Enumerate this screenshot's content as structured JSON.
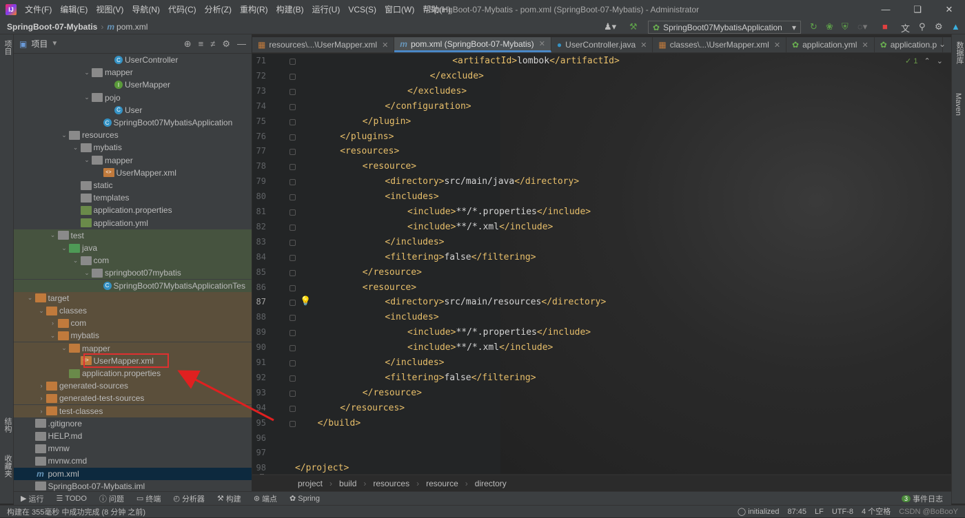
{
  "titlebar": {
    "menu": [
      "文件(F)",
      "编辑(E)",
      "视图(V)",
      "导航(N)",
      "代码(C)",
      "分析(Z)",
      "重构(R)",
      "构建(B)",
      "运行(U)",
      "VCS(S)",
      "窗口(W)",
      "帮助(H)"
    ],
    "window_title": "SpringBoot-07-Mybatis - pom.xml (SpringBoot-07-Mybatis) - Administrator"
  },
  "navbar": {
    "project": "SpringBoot-07-Mybatis",
    "file": "pom.xml",
    "run_config": "SpringBoot07MybatisApplication"
  },
  "left_strip": {
    "project_label": "项目",
    "structure_label": "结构",
    "favorites_label": "收藏夹"
  },
  "right_strip": {
    "database_label": "数据库",
    "maven_label": "Maven"
  },
  "project_panel": {
    "title": "项目",
    "tree": [
      {
        "label": "UserController",
        "indent": 8,
        "icon": "class",
        "arrow": ""
      },
      {
        "label": "mapper",
        "indent": 6,
        "icon": "folder",
        "arrow": "v"
      },
      {
        "label": "UserMapper",
        "indent": 8,
        "icon": "interface",
        "arrow": ""
      },
      {
        "label": "pojo",
        "indent": 6,
        "icon": "folder",
        "arrow": "v"
      },
      {
        "label": "User",
        "indent": 8,
        "icon": "class",
        "arrow": ""
      },
      {
        "label": "SpringBoot07MybatisApplication",
        "indent": 7,
        "icon": "springclass",
        "arrow": ""
      },
      {
        "label": "resources",
        "indent": 4,
        "icon": "folder",
        "arrow": "v"
      },
      {
        "label": "mybatis",
        "indent": 5,
        "icon": "folder",
        "arrow": "v"
      },
      {
        "label": "mapper",
        "indent": 6,
        "icon": "folder",
        "arrow": "v"
      },
      {
        "label": "UserMapper.xml",
        "indent": 7,
        "icon": "xml",
        "arrow": ""
      },
      {
        "label": "static",
        "indent": 5,
        "icon": "folder",
        "arrow": ""
      },
      {
        "label": "templates",
        "indent": 5,
        "icon": "folder",
        "arrow": ""
      },
      {
        "label": "application.properties",
        "indent": 5,
        "icon": "prop",
        "arrow": ""
      },
      {
        "label": "application.yml",
        "indent": 5,
        "icon": "prop",
        "arrow": ""
      },
      {
        "label": "test",
        "indent": 3,
        "icon": "folder",
        "arrow": "v",
        "hl": "green"
      },
      {
        "label": "java",
        "indent": 4,
        "icon": "folder-src",
        "arrow": "v",
        "hl": "green"
      },
      {
        "label": "com",
        "indent": 5,
        "icon": "folder",
        "arrow": "v",
        "hl": "green"
      },
      {
        "label": "springboot07mybatis",
        "indent": 6,
        "icon": "folder",
        "arrow": "v",
        "hl": "green"
      },
      {
        "label": "SpringBoot07MybatisApplicationTes",
        "indent": 7,
        "icon": "springclass",
        "arrow": "",
        "hl": "green"
      },
      {
        "label": "target",
        "indent": 1,
        "icon": "folder-orange",
        "arrow": "v",
        "hl": "orange"
      },
      {
        "label": "classes",
        "indent": 2,
        "icon": "folder-orange",
        "arrow": "v",
        "hl": "orange"
      },
      {
        "label": "com",
        "indent": 3,
        "icon": "folder-orange",
        "arrow": ">",
        "hl": "orange"
      },
      {
        "label": "mybatis",
        "indent": 3,
        "icon": "folder-orange",
        "arrow": "v",
        "hl": "orange"
      },
      {
        "label": "mapper",
        "indent": 4,
        "icon": "folder-orange",
        "arrow": "v",
        "hl": "orange"
      },
      {
        "label": "UserMapper.xml",
        "indent": 5,
        "icon": "xml",
        "arrow": "",
        "hl": "orange"
      },
      {
        "label": "application.properties",
        "indent": 4,
        "icon": "prop",
        "arrow": "",
        "hl": "orange"
      },
      {
        "label": "generated-sources",
        "indent": 2,
        "icon": "folder-orange",
        "arrow": ">",
        "hl": "orange"
      },
      {
        "label": "generated-test-sources",
        "indent": 2,
        "icon": "folder-orange",
        "arrow": ">",
        "hl": "orange"
      },
      {
        "label": "test-classes",
        "indent": 2,
        "icon": "folder-orange",
        "arrow": ">",
        "hl": "orange"
      },
      {
        "label": ".gitignore",
        "indent": 1,
        "icon": "txt",
        "arrow": ""
      },
      {
        "label": "HELP.md",
        "indent": 1,
        "icon": "txt",
        "arrow": ""
      },
      {
        "label": "mvnw",
        "indent": 1,
        "icon": "txt",
        "arrow": ""
      },
      {
        "label": "mvnw.cmd",
        "indent": 1,
        "icon": "txt",
        "arrow": ""
      },
      {
        "label": "pom.xml",
        "indent": 1,
        "icon": "maven",
        "arrow": "",
        "selected": true
      },
      {
        "label": "SpringBoot-07-Mybatis.iml",
        "indent": 1,
        "icon": "txt",
        "arrow": ""
      }
    ]
  },
  "tabs": [
    {
      "label": "resources\\...\\UserMapper.xml",
      "active": false
    },
    {
      "label": "pom.xml (SpringBoot-07-Mybatis)",
      "active": true
    },
    {
      "label": "UserController.java",
      "active": false
    },
    {
      "label": "classes\\...\\UserMapper.xml",
      "active": false
    },
    {
      "label": "application.yml",
      "active": false
    },
    {
      "label": "application.p",
      "active": false
    }
  ],
  "editor": {
    "inspection_count": "1",
    "current_line": 87,
    "lines": [
      {
        "n": 71,
        "indent": 14,
        "parts": [
          [
            "tg",
            "<artifactId>"
          ],
          [
            "tx",
            "lombok"
          ],
          [
            "tg",
            "</artifactId>"
          ]
        ]
      },
      {
        "n": 72,
        "indent": 12,
        "parts": [
          [
            "tg",
            "</exclude>"
          ]
        ]
      },
      {
        "n": 73,
        "indent": 10,
        "parts": [
          [
            "tg",
            "</excludes>"
          ]
        ]
      },
      {
        "n": 74,
        "indent": 8,
        "parts": [
          [
            "tg",
            "</configuration>"
          ]
        ]
      },
      {
        "n": 75,
        "indent": 6,
        "parts": [
          [
            "tg",
            "</plugin>"
          ]
        ]
      },
      {
        "n": 76,
        "indent": 4,
        "parts": [
          [
            "tg",
            "</plugins>"
          ]
        ]
      },
      {
        "n": 77,
        "indent": 4,
        "parts": [
          [
            "tg",
            "<resources>"
          ]
        ]
      },
      {
        "n": 78,
        "indent": 6,
        "parts": [
          [
            "tg",
            "<resource>"
          ]
        ]
      },
      {
        "n": 79,
        "indent": 8,
        "parts": [
          [
            "tg",
            "<directory>"
          ],
          [
            "tx",
            "src/main/java"
          ],
          [
            "tg",
            "</directory>"
          ]
        ]
      },
      {
        "n": 80,
        "indent": 8,
        "parts": [
          [
            "tg",
            "<includes>"
          ]
        ]
      },
      {
        "n": 81,
        "indent": 10,
        "parts": [
          [
            "tg",
            "<include>"
          ],
          [
            "tx",
            "**/*.properties"
          ],
          [
            "tg",
            "</include>"
          ]
        ]
      },
      {
        "n": 82,
        "indent": 10,
        "parts": [
          [
            "tg",
            "<include>"
          ],
          [
            "tx",
            "**/*.xml"
          ],
          [
            "tg",
            "</include>"
          ]
        ]
      },
      {
        "n": 83,
        "indent": 8,
        "parts": [
          [
            "tg",
            "</includes>"
          ]
        ]
      },
      {
        "n": 84,
        "indent": 8,
        "parts": [
          [
            "tg",
            "<filtering>"
          ],
          [
            "tx",
            "false"
          ],
          [
            "tg",
            "</filtering>"
          ]
        ]
      },
      {
        "n": 85,
        "indent": 6,
        "parts": [
          [
            "tg",
            "</resource>"
          ]
        ]
      },
      {
        "n": 86,
        "indent": 6,
        "parts": [
          [
            "tg",
            "<resource>"
          ]
        ]
      },
      {
        "n": 87,
        "indent": 8,
        "parts": [
          [
            "tg",
            "<directory>"
          ],
          [
            "tx",
            "src/main/resources"
          ],
          [
            "tg",
            "</directory>"
          ]
        ]
      },
      {
        "n": 88,
        "indent": 8,
        "parts": [
          [
            "tg",
            "<includes>"
          ]
        ]
      },
      {
        "n": 89,
        "indent": 10,
        "parts": [
          [
            "tg",
            "<include>"
          ],
          [
            "tx",
            "**/*.properties"
          ],
          [
            "tg",
            "</include>"
          ]
        ]
      },
      {
        "n": 90,
        "indent": 10,
        "parts": [
          [
            "tg",
            "<include>"
          ],
          [
            "tx",
            "**/*.xml"
          ],
          [
            "tg",
            "</include>"
          ]
        ]
      },
      {
        "n": 91,
        "indent": 8,
        "parts": [
          [
            "tg",
            "</includes>"
          ]
        ]
      },
      {
        "n": 92,
        "indent": 8,
        "parts": [
          [
            "tg",
            "<filtering>"
          ],
          [
            "tx",
            "false"
          ],
          [
            "tg",
            "</filtering>"
          ]
        ]
      },
      {
        "n": 93,
        "indent": 6,
        "parts": [
          [
            "tg",
            "</resource>"
          ]
        ]
      },
      {
        "n": 94,
        "indent": 4,
        "parts": [
          [
            "tg",
            "</resources>"
          ]
        ]
      },
      {
        "n": 95,
        "indent": 2,
        "parts": [
          [
            "tg",
            "</build>"
          ]
        ]
      },
      {
        "n": 96,
        "indent": 0,
        "parts": []
      },
      {
        "n": 97,
        "indent": 0,
        "parts": []
      },
      {
        "n": 98,
        "indent": 0,
        "parts": [
          [
            "tg",
            "</project>"
          ]
        ]
      }
    ]
  },
  "editor_breadcrumb": [
    "project",
    "build",
    "resources",
    "resource",
    "directory"
  ],
  "bottom_tools": [
    {
      "icon": "run-icon",
      "label": "运行"
    },
    {
      "icon": "todo-icon",
      "label": "TODO"
    },
    {
      "icon": "problems-icon",
      "label": "问题"
    },
    {
      "icon": "terminal-icon",
      "label": "终端"
    },
    {
      "icon": "profiler-icon",
      "label": "分析器"
    },
    {
      "icon": "build-icon",
      "label": "构建"
    },
    {
      "icon": "endpoints-icon",
      "label": "端点"
    },
    {
      "icon": "spring-icon",
      "label": "Spring"
    }
  ],
  "event_log": {
    "count": "3",
    "label": "事件日志"
  },
  "status": {
    "message": "构建在 355毫秒 中成功完成 (8 分钟 之前)",
    "indexing": "initialized",
    "position": "87:45",
    "line_sep": "LF",
    "encoding": "UTF-8",
    "indent": "4 个空格",
    "watermark": "CSDN @BoBooY"
  }
}
